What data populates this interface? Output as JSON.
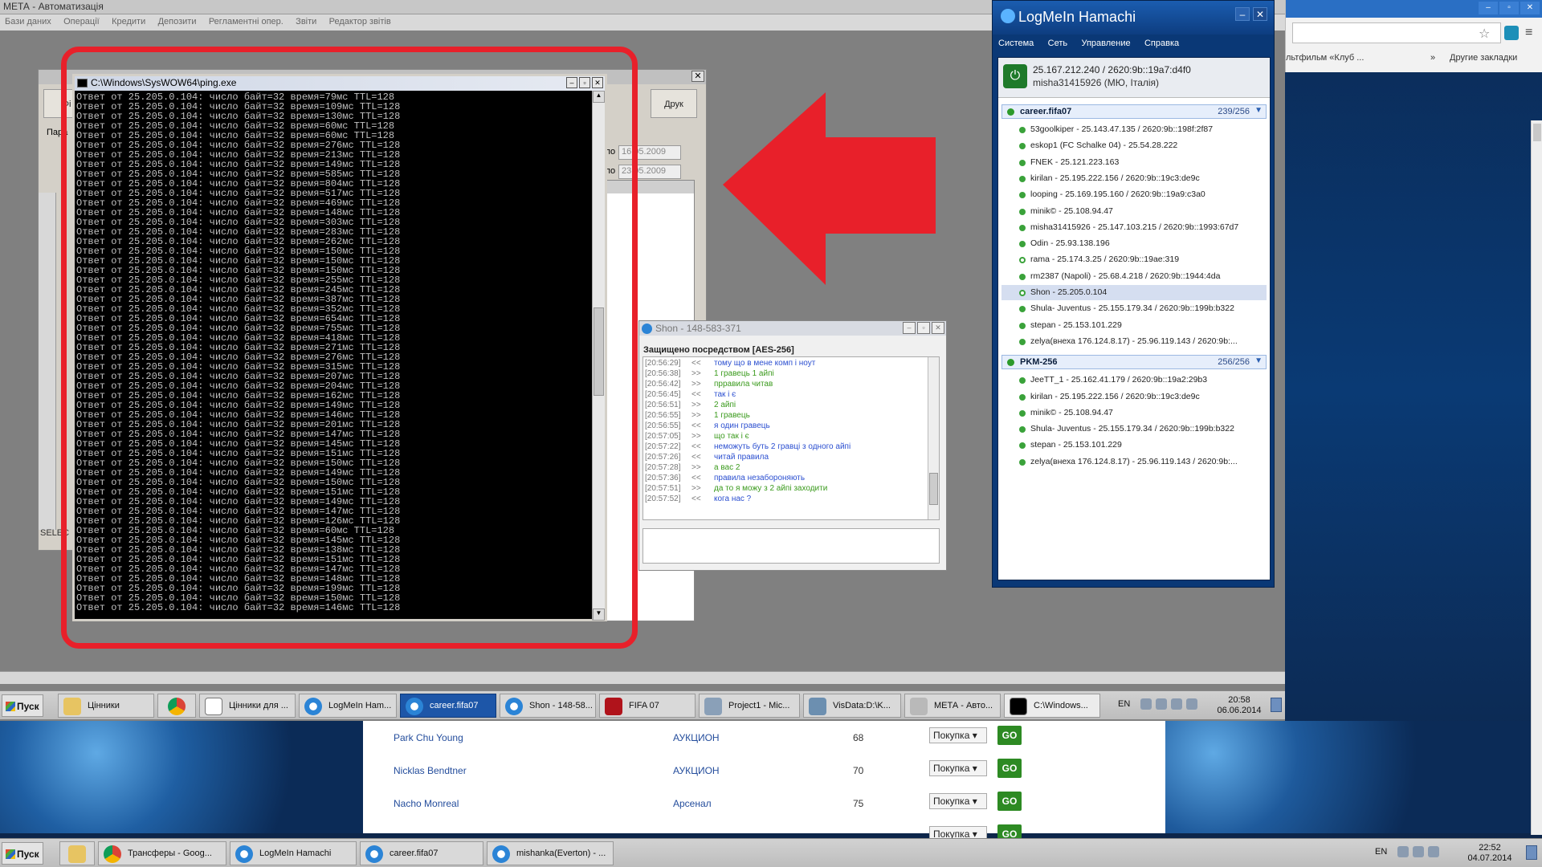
{
  "app": {
    "title": "МЕТА - Автоматизація",
    "menu": [
      "Бази даних",
      "Операції",
      "Кредити",
      "Депозити",
      "Регламентні опер.",
      "Звіти",
      "Редактор звітів"
    ]
  },
  "meta_dialog": {
    "buttons": [
      "Фі",
      "Друк"
    ],
    "label_pari": "Пара",
    "date_from": "16.05.2009",
    "date_to": "23.05.2009",
    "label_po": "по",
    "sql_label": "SELEC"
  },
  "ping": {
    "title": "C:\\Windows\\SysWOW64\\ping.exe",
    "line_prefix": "Ответ от 25.205.0.104: число байт=32 время=",
    "line_suffix": " TTL=128",
    "times_ms": [
      "79мс",
      "109мс",
      "130мс",
      "60мс",
      "60мс",
      "276мс",
      "213мс",
      "149мс",
      "585мс",
      "804мс",
      "517мс",
      "469мс",
      "148мс",
      "303мс",
      "283мс",
      "262мс",
      "150мс",
      "150мс",
      "150мс",
      "255мс",
      "245мс",
      "387мс",
      "352мс",
      "654мс",
      "755мс",
      "418мс",
      "271мс",
      "276мс",
      "315мс",
      "207мс",
      "204мс",
      "162мс",
      "149мс",
      "146мс",
      "201мс",
      "147мс",
      "145мс",
      "151мс",
      "150мс",
      "149мс",
      "150мс",
      "151мс",
      "149мс",
      "147мс",
      "126мс",
      "60мс",
      "145мс",
      "138мс",
      "151мс",
      "147мс",
      "148мс",
      "199мс",
      "150мс",
      "146мс"
    ]
  },
  "chat": {
    "title": "Shon - 148-583-371",
    "security": "Защищено посредством [AES-256]",
    "messages": [
      {
        "time": "[20:56:29]",
        "dir": "<<",
        "text": "тому що в мене комп і ноут",
        "type": "in"
      },
      {
        "time": "[20:56:38]",
        "dir": ">>",
        "text": "1 гравець 1 айпі",
        "type": "out"
      },
      {
        "time": "[20:56:42]",
        "dir": ">>",
        "text": "прравила читав",
        "type": "out"
      },
      {
        "time": "[20:56:45]",
        "dir": "<<",
        "text": "так і є",
        "type": "in"
      },
      {
        "time": "[20:56:51]",
        "dir": ">>",
        "text": "2 айпі",
        "type": "out"
      },
      {
        "time": "[20:56:55]",
        "dir": ">>",
        "text": "1 гравець",
        "type": "out"
      },
      {
        "time": "[20:56:55]",
        "dir": "<<",
        "text": "я один гравець",
        "type": "in"
      },
      {
        "time": "[20:57:05]",
        "dir": ">>",
        "text": "що так і є",
        "type": "out"
      },
      {
        "time": "[20:57:22]",
        "dir": "<<",
        "text": "неможуть буть 2 гравці з одного айпі",
        "type": "in"
      },
      {
        "time": "[20:57:26]",
        "dir": "<<",
        "text": "читай правила",
        "type": "in"
      },
      {
        "time": "[20:57:28]",
        "dir": ">>",
        "text": "а вас 2",
        "type": "out"
      },
      {
        "time": "[20:57:36]",
        "dir": "<<",
        "text": "правила незабороняють",
        "type": "in"
      },
      {
        "time": "[20:57:51]",
        "dir": ">>",
        "text": "да то я можу з 2 айпі заходити",
        "type": "out"
      },
      {
        "time": "[20:57:52]",
        "dir": "<<",
        "text": "кога нас ?",
        "type": "in"
      }
    ]
  },
  "hamachi": {
    "title": "LogMeIn Hamachi",
    "menu": [
      "Система",
      "Сеть",
      "Управление",
      "Справка"
    ],
    "ip": "25.167.212.240 / 2620:9b::19a7:d4f0",
    "user": "misha31415926 (MЮ, Італія)",
    "networks": [
      {
        "name": "career.fifa07",
        "count": "239/256",
        "peers": [
          {
            "label": "53goolkiper - 25.143.47.135 / 2620:9b::198f:2f87",
            "relay": false,
            "selected": false
          },
          {
            "label": "eskop1 (FC Schalke 04) - 25.54.28.222",
            "relay": false,
            "selected": false
          },
          {
            "label": "FNEK - 25.121.223.163",
            "relay": false,
            "selected": false
          },
          {
            "label": "kirilan - 25.195.222.156 / 2620:9b::19c3:de9c",
            "relay": false,
            "selected": false
          },
          {
            "label": "looping - 25.169.195.160 / 2620:9b::19a9:c3a0",
            "relay": false,
            "selected": false
          },
          {
            "label": "minik© - 25.108.94.47",
            "relay": false,
            "selected": false
          },
          {
            "label": "misha31415926 - 25.147.103.215 / 2620:9b::1993:67d7",
            "relay": false,
            "selected": false
          },
          {
            "label": "Odin  - 25.93.138.196",
            "relay": false,
            "selected": false
          },
          {
            "label": "rama - 25.174.3.25 / 2620:9b::19ae:319",
            "relay": true,
            "selected": false
          },
          {
            "label": "rm2387 (Napoli) - 25.68.4.218 / 2620:9b::1944:4da",
            "relay": false,
            "selected": false
          },
          {
            "label": "Shon - 25.205.0.104",
            "relay": true,
            "selected": true
          },
          {
            "label": "Shula- Juventus - 25.155.179.34 / 2620:9b::199b:b322",
            "relay": false,
            "selected": false
          },
          {
            "label": "stepan - 25.153.101.229",
            "relay": false,
            "selected": false
          },
          {
            "label": "zelya(внеха 176.124.8.17) - 25.96.119.143 / 2620:9b:...",
            "relay": false,
            "selected": false
          }
        ]
      },
      {
        "name": "PKM-256",
        "count": "256/256",
        "peers": [
          {
            "label": "JeeTT_1 - 25.162.41.179 / 2620:9b::19a2:29b3",
            "relay": false,
            "selected": false
          },
          {
            "label": "kirilan - 25.195.222.156 / 2620:9b::19c3:de9c",
            "relay": false,
            "selected": false
          },
          {
            "label": "minik© - 25.108.94.47",
            "relay": false,
            "selected": false
          },
          {
            "label": "Shula- Juventus - 25.155.179.34 / 2620:9b::199b:b322",
            "relay": false,
            "selected": false
          },
          {
            "label": "stepan - 25.153.101.229",
            "relay": false,
            "selected": false
          },
          {
            "label": "zelya(внеха 176.124.8.17) - 25.96.119.143 / 2620:9b:...",
            "relay": false,
            "selected": false
          }
        ]
      }
    ]
  },
  "browser": {
    "bookmark1": "льтфильм «Клуб ...",
    "bookmark_more": "»",
    "bookmark_other": "Другие закладки",
    "rows": [
      {
        "name": "Park Chu Young",
        "club": "АУКЦИОН",
        "num": "68",
        "action": "Покупка ▾",
        "go": "GO"
      },
      {
        "name": "Nicklas Bendtner",
        "club": "АУКЦИОН",
        "num": "70",
        "action": "Покупка ▾",
        "go": "GO"
      },
      {
        "name": "Nacho Monreal",
        "club": "Арсенал",
        "num": "75",
        "action": "Покупка ▾",
        "go": "GO"
      },
      {
        "name": "",
        "club": "",
        "num": "",
        "action": "Покупка ▾",
        "go": "GO"
      }
    ]
  },
  "taskbar_remote": {
    "start": "Пуск",
    "tasks": [
      "Цінники",
      "",
      "Цінники для ...",
      "LogMeIn Ham...",
      "career.fifa07",
      "Shon - 148-58...",
      "FIFA 07",
      "Project1 - Mic...",
      "VisData:D:\\K...",
      "МЕТА - Авто...",
      "C:\\Windows..."
    ],
    "lang": "EN",
    "time": "20:58",
    "date": "06.06.2014"
  },
  "taskbar_local": {
    "start": "Пуск",
    "tasks": [
      "",
      "Трансферы - Goog...",
      "LogMeIn Hamachi",
      "career.fifa07",
      "mishanka(Everton) - ..."
    ],
    "lang": "EN",
    "time": "22:52",
    "date": "04.07.2014"
  }
}
